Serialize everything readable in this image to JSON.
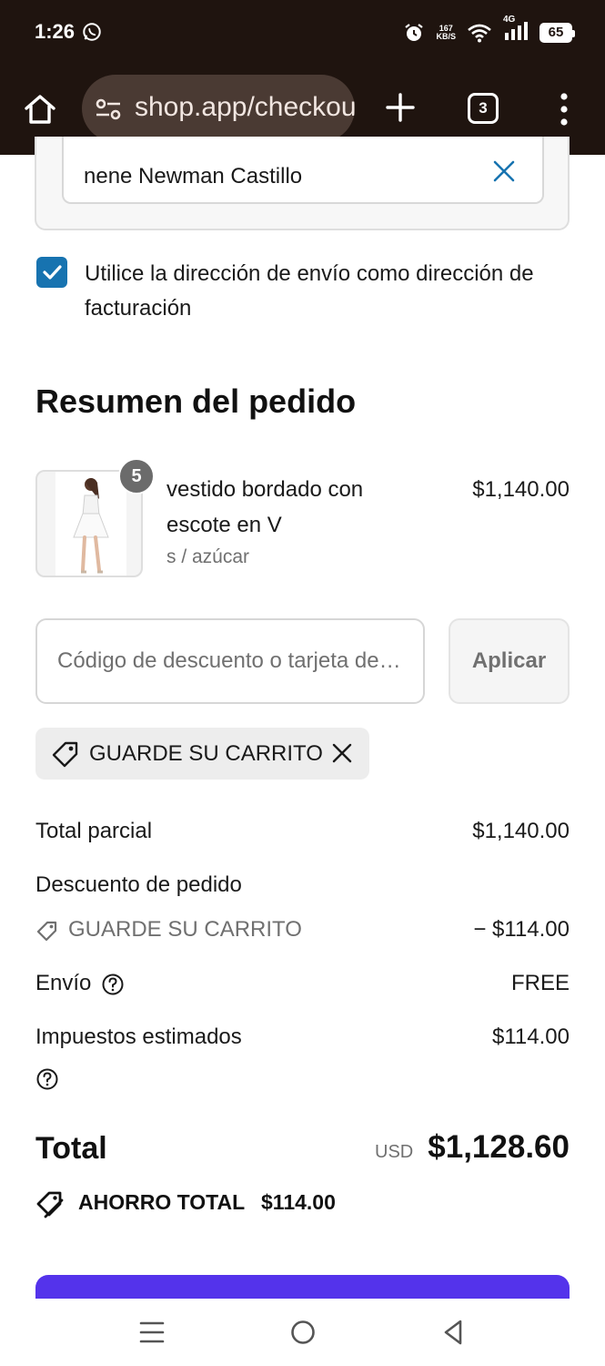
{
  "status_bar": {
    "time": "1:26",
    "network_speed_top": "167",
    "network_speed_bottom": "KB/S",
    "network_type": "4G",
    "battery": "65"
  },
  "browser": {
    "url": "shop.app/checkout",
    "tab_count": "3"
  },
  "address": {
    "value": "nene Newman Castillo"
  },
  "billing_checkbox": {
    "checked": true,
    "label": "Utilice la dirección de envío como dirección de facturación"
  },
  "order_summary": {
    "title": "Resumen del pedido",
    "item": {
      "quantity": "5",
      "name": "vestido bordado con escote en V",
      "variant": "s / azúcar",
      "price": "$1,140.00"
    },
    "discount_input": {
      "placeholder": "Código de descuento o tarjeta de regalo",
      "apply_label": "Aplicar"
    },
    "applied_code": "GUARDE SU CARRITO",
    "rows": {
      "subtotal_label": "Total parcial",
      "subtotal_value": "$1,140.00",
      "discount_label": "Descuento de pedido",
      "discount_code": "GUARDE SU CARRITO",
      "discount_value": "− $114.00",
      "shipping_label": "Envío",
      "shipping_value": "FREE",
      "taxes_label": "Impuestos estimados",
      "taxes_value": "$114.00"
    },
    "total": {
      "label": "Total",
      "currency": "USD",
      "value": "$1,128.60"
    },
    "savings": {
      "label": "AHORRO TOTAL",
      "value": "$114.00"
    }
  },
  "colors": {
    "browser_chrome": "#1f140f",
    "checkbox_accent": "#1773b0",
    "pay_button": "#5433eb"
  }
}
